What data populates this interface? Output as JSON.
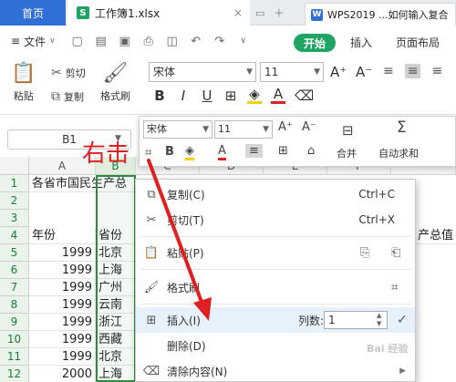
{
  "tabbar": {
    "home_label": "首页",
    "file_tab_badge": "S",
    "file_tab_label": "工作簿1.xlsx",
    "file_tab_close": "×",
    "other_tab_badge": "W",
    "other_tab_label": "WPS2019 ...如何输入复合"
  },
  "menubar": {
    "file_label": "文件",
    "start_label": "开始",
    "insert_label": "插入",
    "layout_label": "页面布局"
  },
  "ribbon": {
    "paste_label": "粘贴",
    "cut_label": "剪切",
    "copy_label": "复制",
    "format_painter_label": "格式刷",
    "font_name": "宋体",
    "font_size": "11",
    "bold": "B",
    "italic": "I",
    "underline": "U",
    "font_color_glyph": "A"
  },
  "formula": {
    "name_box": "B1"
  },
  "grid": {
    "columns": [
      "A",
      "B",
      "C",
      "D",
      "E",
      "F"
    ],
    "rows": [
      "1",
      "2",
      "3",
      "4",
      "5",
      "6",
      "7",
      "8",
      "9",
      "10",
      "11",
      "12",
      "13"
    ],
    "a1": "各省市国民生产总",
    "a4": "年份",
    "b4": "省份",
    "f4": "产总值",
    "years": [
      "1999",
      "1999",
      "1999",
      "1999",
      "1999",
      "1999",
      "1999",
      "2000",
      "2000"
    ],
    "provinces": [
      "北京",
      "上海",
      "广州",
      "云南",
      "浙江",
      "西藏",
      "北京",
      "上海",
      "广州"
    ]
  },
  "annotation": "右击",
  "mini_toolbar": {
    "font_name": "宋体",
    "font_size": "11",
    "merge_label": "合并",
    "autosum_label": "自动求和"
  },
  "context_menu": {
    "copy": "复制(C)",
    "copy_shortcut": "Ctrl+C",
    "cut": "剪切(T)",
    "cut_shortcut": "Ctrl+X",
    "paste": "粘贴(P)",
    "format_painter": "格式刷",
    "insert": "插入(I)",
    "columns_label": "列数:",
    "columns_value": "1",
    "delete": "删除(D)",
    "clear": "清除内容(N)"
  },
  "colors": {
    "accent_green": "#1fa463",
    "brand_blue": "#2f6fd6",
    "annotation_red": "#e02020"
  }
}
